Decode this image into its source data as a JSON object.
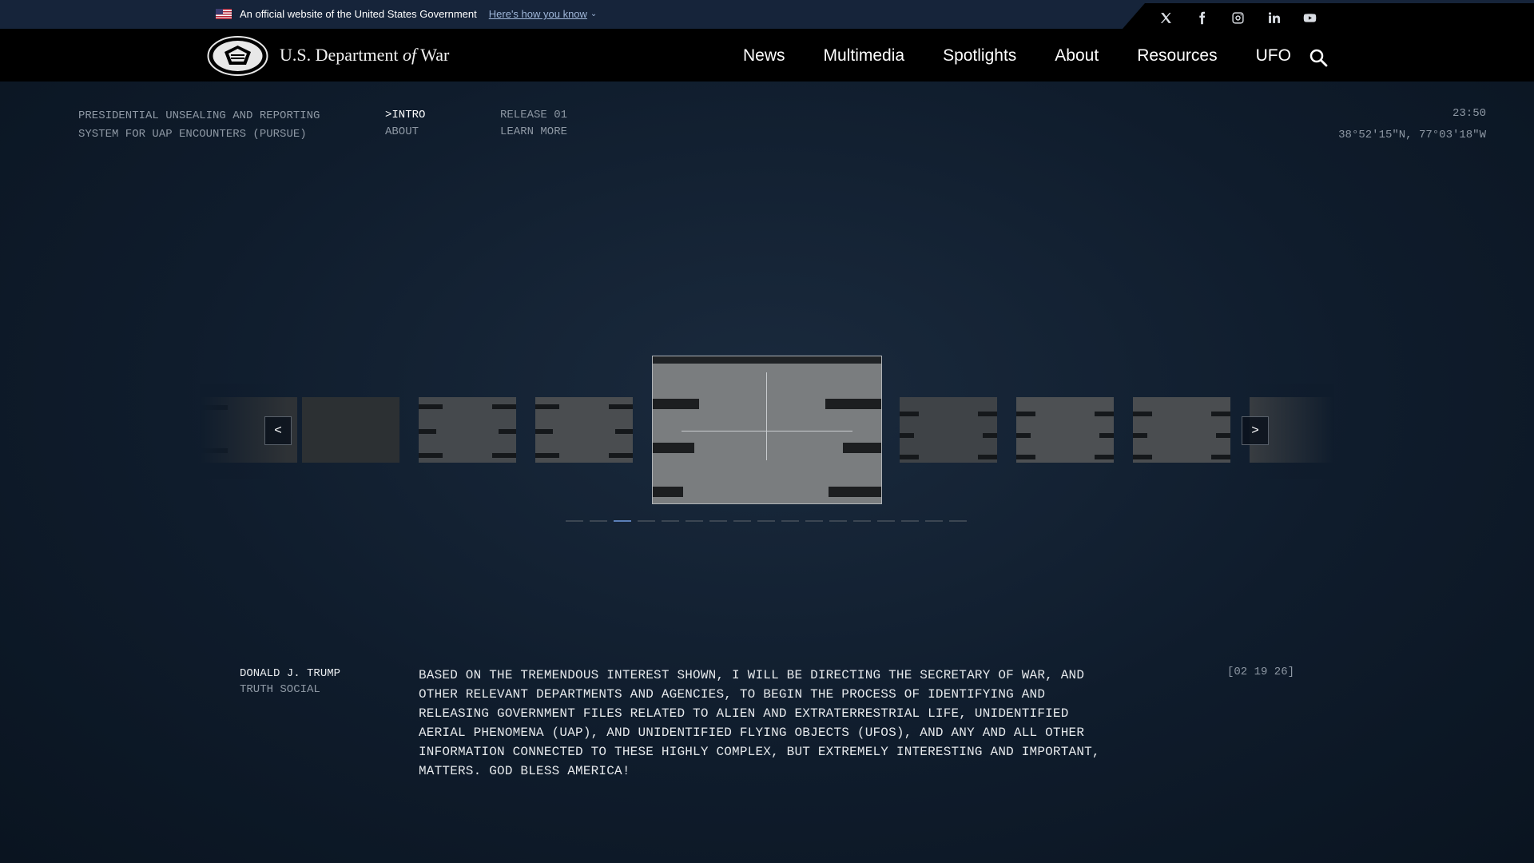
{
  "gov_banner": {
    "text": "An official website of the United States Government",
    "link": "Here's how you know",
    "chevron": "⌄"
  },
  "social": [
    "x-icon",
    "facebook-icon",
    "instagram-icon",
    "linkedin-icon",
    "youtube-icon"
  ],
  "header": {
    "dept_prefix": "U.S. Department",
    "dept_of": "of",
    "dept_suffix": "War",
    "nav": [
      "News",
      "Multimedia",
      "Spotlights",
      "About",
      "Resources",
      "UFO"
    ]
  },
  "hero": {
    "title": "PRESIDENTIAL UNSEALING AND REPORTING SYSTEM FOR UAP ENCOUNTERS (PURSUE)",
    "col1_prefix": ">",
    "col1": [
      "INTRO",
      "ABOUT"
    ],
    "col2": [
      "RELEASE 01",
      "LEARN MORE"
    ],
    "time": "23:50",
    "coords": "38°52'15\"N, 77°03'18\"W"
  },
  "carousel": {
    "prev": "<",
    "next": ">",
    "dot_count": 17,
    "active_dot": 2
  },
  "quote": {
    "name": "DONALD J. TRUMP",
    "source": "TRUTH SOCIAL",
    "text": "BASED ON THE TREMENDOUS INTEREST SHOWN, I WILL BE DIRECTING THE SECRETARY OF WAR, AND OTHER RELEVANT DEPARTMENTS AND AGENCIES, TO BEGIN THE PROCESS OF IDENTIFYING AND RELEASING GOVERNMENT FILES RELATED TO ALIEN AND EXTRATERRESTRIAL LIFE, UNIDENTIFIED AERIAL PHENOMENA (UAP), AND UNIDENTIFIED FLYING OBJECTS (UFOS), AND ANY AND ALL OTHER INFORMATION CONNECTED TO THESE HIGHLY COMPLEX, BUT EXTREMELY INTERESTING AND IMPORTANT, MATTERS. GOD BLESS AMERICA!",
    "date": "[02 19 26]"
  },
  "colors": {
    "background": "#0b1624",
    "gov_bar": "#16243a",
    "nav": "#000000",
    "dim_text": "#8e98a4",
    "active_dot": "#5b7fb8"
  }
}
